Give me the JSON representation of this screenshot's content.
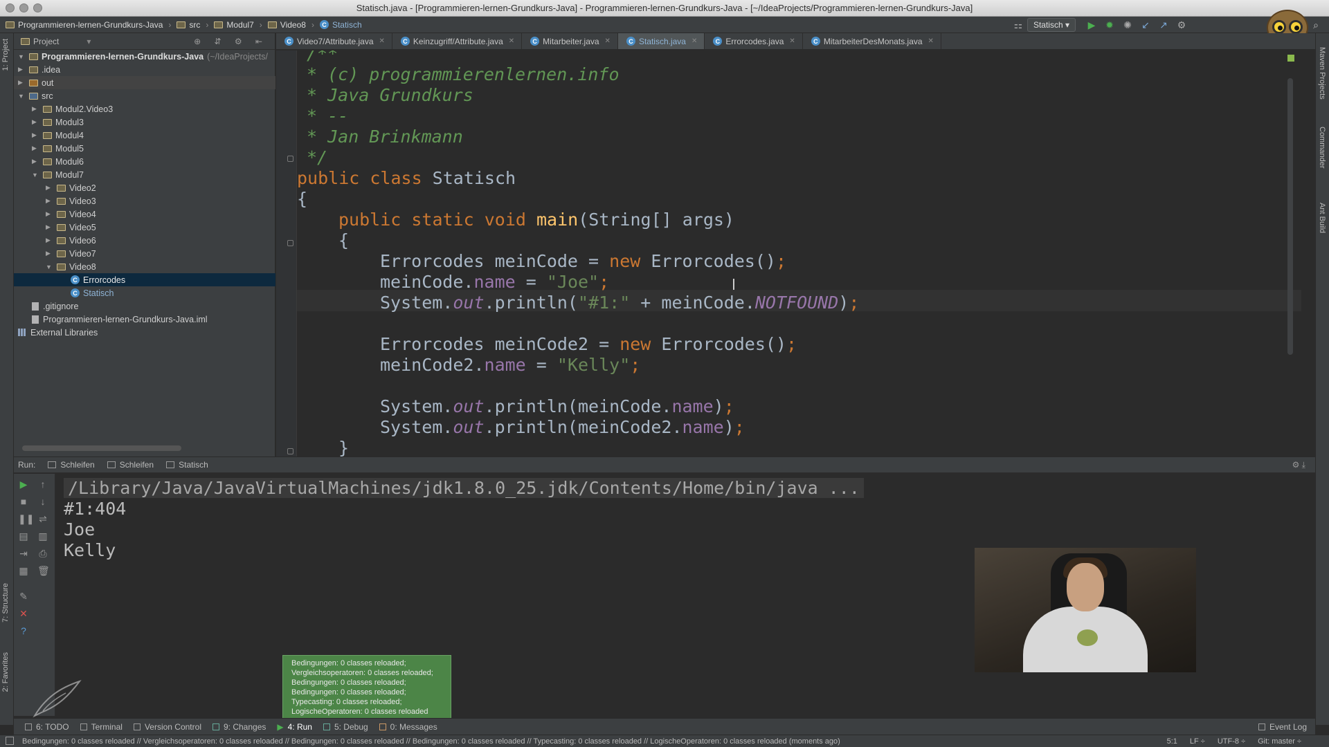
{
  "window": {
    "title": "Statisch.java - [Programmieren-lernen-Grundkurs-Java] - Programmieren-lernen-Grundkurs-Java - [~/IdeaProjects/Programmieren-lernen-Grundkurs-Java]"
  },
  "breadcrumbs": [
    "Programmieren-lernen-Grundkurs-Java",
    "src",
    "Modul7",
    "Video8",
    "Statisch"
  ],
  "toolbar": {
    "run_config": "Statisch"
  },
  "project_panel": {
    "header": "Project",
    "root": "Programmieren-lernen-Grundkurs-Java",
    "root_path": "(~/IdeaProjects/",
    "items": [
      ".idea",
      "out",
      "src",
      "Modul2.Video3",
      "Modul3",
      "Modul4",
      "Modul5",
      "Modul6",
      "Modul7",
      "Video2",
      "Video3",
      "Video4",
      "Video5",
      "Video6",
      "Video7",
      "Video8",
      "Errorcodes",
      "Statisch",
      ".gitignore",
      "Programmieren-lernen-Grundkurs-Java.iml",
      "External Libraries"
    ]
  },
  "tabs": [
    "Video7/Attribute.java",
    "Keinzugriff/Attribute.java",
    "Mitarbeiter.java",
    "Statisch.java",
    "Errorcodes.java",
    "MitarbeiterDesMonats.java"
  ],
  "code": {
    "l1": "* (c) programmierenlernen.info",
    "l2": "* Java Grundkurs",
    "l3": "* --",
    "l4": "* Jan Brinkmann",
    "l5": "*/"
  },
  "run_panel": {
    "label": "Run:",
    "tabs": [
      "Schleifen",
      "Schleifen",
      "Statisch"
    ],
    "output": [
      "/Library/Java/JavaVirtualMachines/jdk1.8.0_25.jdk/Contents/Home/bin/java ...",
      "#1:404",
      "Joe",
      "Kelly"
    ]
  },
  "toast": {
    "lines": [
      "Bedingungen: 0 classes reloaded;",
      "Vergleichsoperatoren: 0 classes reloaded;",
      "Bedingungen: 0 classes reloaded;",
      "Bedingungen: 0 classes reloaded;",
      "Typecasting: 0 classes reloaded;",
      "LogischeOperatoren: 0 classes reloaded"
    ]
  },
  "side_labels": {
    "left_project": "1: Project",
    "left_structure": "7: Structure",
    "left_favorites": "2: Favorites",
    "right_maven": "Maven Projects",
    "right_commander": "Commander",
    "right_ant": "Ant Build"
  },
  "bottom_tools": [
    "6: TODO",
    "Terminal",
    "Version Control",
    "9: Changes",
    "4: Run",
    "5: Debug",
    "0: Messages",
    "Event Log"
  ],
  "status": {
    "message": "Bedingungen: 0 classes reloaded // Vergleichsoperatoren: 0 classes reloaded // Bedingungen: 0 classes reloaded // Bedingungen: 0 classes reloaded // Typecasting: 0 classes reloaded // LogischeOperatoren: 0 classes reloaded (moments ago)",
    "position": "5:1",
    "line_sep": "LF ÷",
    "encoding": "UTF-8 ÷",
    "git": "Git: master ÷"
  }
}
